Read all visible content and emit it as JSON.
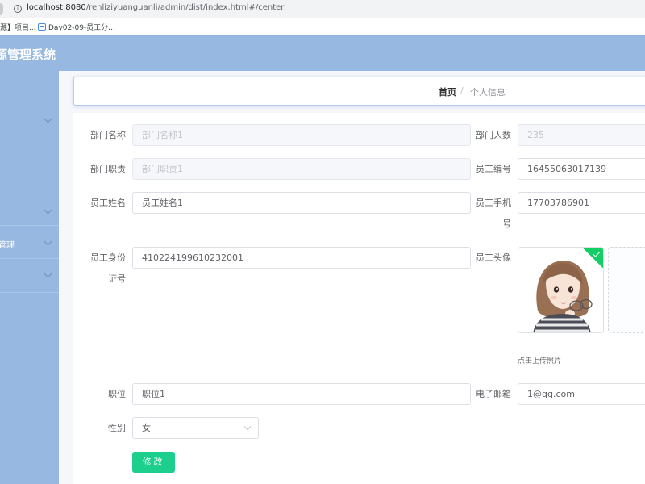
{
  "browser": {
    "url_host": "localhost:8080",
    "url_path": "/renliziyuanguanli/admin/dist/index.html#/center",
    "bookmarks": [
      "源】项目...",
      "Day02-09-员工分..."
    ]
  },
  "app": {
    "title": "源管理系统"
  },
  "sidebar": {
    "items": [
      {
        "label": ""
      },
      {
        "label": ""
      },
      {
        "label": ""
      },
      {
        "label": "管理"
      },
      {
        "label": ""
      }
    ]
  },
  "breadcrumb": {
    "home": "首页",
    "separator": "/",
    "current": "个人信息"
  },
  "form": {
    "dept_name": {
      "label": "部门名称",
      "placeholder": "部门名称1"
    },
    "dept_count": {
      "label": "部门人数",
      "placeholder": "235"
    },
    "dept_duty": {
      "label": "部门职责",
      "placeholder": "部门职责1"
    },
    "emp_no": {
      "label": "员工编号",
      "value": "16455063017139"
    },
    "emp_name": {
      "label": "员工姓名",
      "value": "员工姓名1"
    },
    "emp_phone": {
      "label_line1": "员工手机",
      "label_line2": "号",
      "value": "17703786901"
    },
    "emp_id": {
      "label_line1": "员工身份",
      "label_line2": "证号",
      "value": "410224199610232001"
    },
    "emp_avatar": {
      "label": "员工头像",
      "upload_tip": "点击上传照片",
      "upload_plus": "+"
    },
    "position": {
      "label": "职位",
      "value": "职位1"
    },
    "email": {
      "label": "电子邮箱",
      "value": "1@qq.com"
    },
    "gender": {
      "label": "性别",
      "value": "女"
    },
    "submit": "修改"
  },
  "colors": {
    "header": "#97b8e1",
    "button": "#1ccf8c",
    "badge": "#13ce66"
  }
}
